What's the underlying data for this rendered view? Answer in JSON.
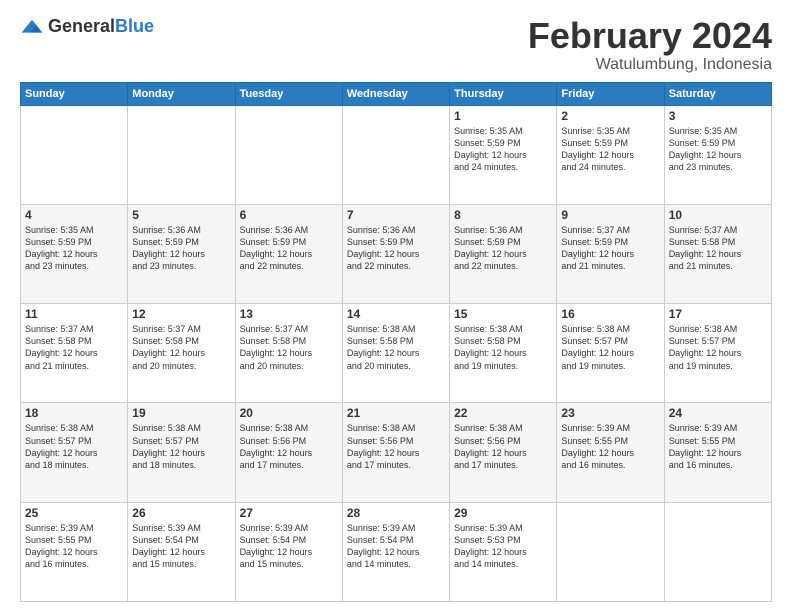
{
  "logo": {
    "general": "General",
    "blue": "Blue"
  },
  "header": {
    "month": "February 2024",
    "location": "Watulumbung, Indonesia"
  },
  "weekdays": [
    "Sunday",
    "Monday",
    "Tuesday",
    "Wednesday",
    "Thursday",
    "Friday",
    "Saturday"
  ],
  "weeks": [
    [
      {
        "day": "",
        "info": ""
      },
      {
        "day": "",
        "info": ""
      },
      {
        "day": "",
        "info": ""
      },
      {
        "day": "",
        "info": ""
      },
      {
        "day": "1",
        "info": "Sunrise: 5:35 AM\nSunset: 5:59 PM\nDaylight: 12 hours\nand 24 minutes."
      },
      {
        "day": "2",
        "info": "Sunrise: 5:35 AM\nSunset: 5:59 PM\nDaylight: 12 hours\nand 24 minutes."
      },
      {
        "day": "3",
        "info": "Sunrise: 5:35 AM\nSunset: 5:59 PM\nDaylight: 12 hours\nand 23 minutes."
      }
    ],
    [
      {
        "day": "4",
        "info": "Sunrise: 5:35 AM\nSunset: 5:59 PM\nDaylight: 12 hours\nand 23 minutes."
      },
      {
        "day": "5",
        "info": "Sunrise: 5:36 AM\nSunset: 5:59 PM\nDaylight: 12 hours\nand 23 minutes."
      },
      {
        "day": "6",
        "info": "Sunrise: 5:36 AM\nSunset: 5:59 PM\nDaylight: 12 hours\nand 22 minutes."
      },
      {
        "day": "7",
        "info": "Sunrise: 5:36 AM\nSunset: 5:59 PM\nDaylight: 12 hours\nand 22 minutes."
      },
      {
        "day": "8",
        "info": "Sunrise: 5:36 AM\nSunset: 5:59 PM\nDaylight: 12 hours\nand 22 minutes."
      },
      {
        "day": "9",
        "info": "Sunrise: 5:37 AM\nSunset: 5:59 PM\nDaylight: 12 hours\nand 21 minutes."
      },
      {
        "day": "10",
        "info": "Sunrise: 5:37 AM\nSunset: 5:58 PM\nDaylight: 12 hours\nand 21 minutes."
      }
    ],
    [
      {
        "day": "11",
        "info": "Sunrise: 5:37 AM\nSunset: 5:58 PM\nDaylight: 12 hours\nand 21 minutes."
      },
      {
        "day": "12",
        "info": "Sunrise: 5:37 AM\nSunset: 5:58 PM\nDaylight: 12 hours\nand 20 minutes."
      },
      {
        "day": "13",
        "info": "Sunrise: 5:37 AM\nSunset: 5:58 PM\nDaylight: 12 hours\nand 20 minutes."
      },
      {
        "day": "14",
        "info": "Sunrise: 5:38 AM\nSunset: 5:58 PM\nDaylight: 12 hours\nand 20 minutes."
      },
      {
        "day": "15",
        "info": "Sunrise: 5:38 AM\nSunset: 5:58 PM\nDaylight: 12 hours\nand 19 minutes."
      },
      {
        "day": "16",
        "info": "Sunrise: 5:38 AM\nSunset: 5:57 PM\nDaylight: 12 hours\nand 19 minutes."
      },
      {
        "day": "17",
        "info": "Sunrise: 5:38 AM\nSunset: 5:57 PM\nDaylight: 12 hours\nand 19 minutes."
      }
    ],
    [
      {
        "day": "18",
        "info": "Sunrise: 5:38 AM\nSunset: 5:57 PM\nDaylight: 12 hours\nand 18 minutes."
      },
      {
        "day": "19",
        "info": "Sunrise: 5:38 AM\nSunset: 5:57 PM\nDaylight: 12 hours\nand 18 minutes."
      },
      {
        "day": "20",
        "info": "Sunrise: 5:38 AM\nSunset: 5:56 PM\nDaylight: 12 hours\nand 17 minutes."
      },
      {
        "day": "21",
        "info": "Sunrise: 5:38 AM\nSunset: 5:56 PM\nDaylight: 12 hours\nand 17 minutes."
      },
      {
        "day": "22",
        "info": "Sunrise: 5:38 AM\nSunset: 5:56 PM\nDaylight: 12 hours\nand 17 minutes."
      },
      {
        "day": "23",
        "info": "Sunrise: 5:39 AM\nSunset: 5:55 PM\nDaylight: 12 hours\nand 16 minutes."
      },
      {
        "day": "24",
        "info": "Sunrise: 5:39 AM\nSunset: 5:55 PM\nDaylight: 12 hours\nand 16 minutes."
      }
    ],
    [
      {
        "day": "25",
        "info": "Sunrise: 5:39 AM\nSunset: 5:55 PM\nDaylight: 12 hours\nand 16 minutes."
      },
      {
        "day": "26",
        "info": "Sunrise: 5:39 AM\nSunset: 5:54 PM\nDaylight: 12 hours\nand 15 minutes."
      },
      {
        "day": "27",
        "info": "Sunrise: 5:39 AM\nSunset: 5:54 PM\nDaylight: 12 hours\nand 15 minutes."
      },
      {
        "day": "28",
        "info": "Sunrise: 5:39 AM\nSunset: 5:54 PM\nDaylight: 12 hours\nand 14 minutes."
      },
      {
        "day": "29",
        "info": "Sunrise: 5:39 AM\nSunset: 5:53 PM\nDaylight: 12 hours\nand 14 minutes."
      },
      {
        "day": "",
        "info": ""
      },
      {
        "day": "",
        "info": ""
      }
    ]
  ]
}
